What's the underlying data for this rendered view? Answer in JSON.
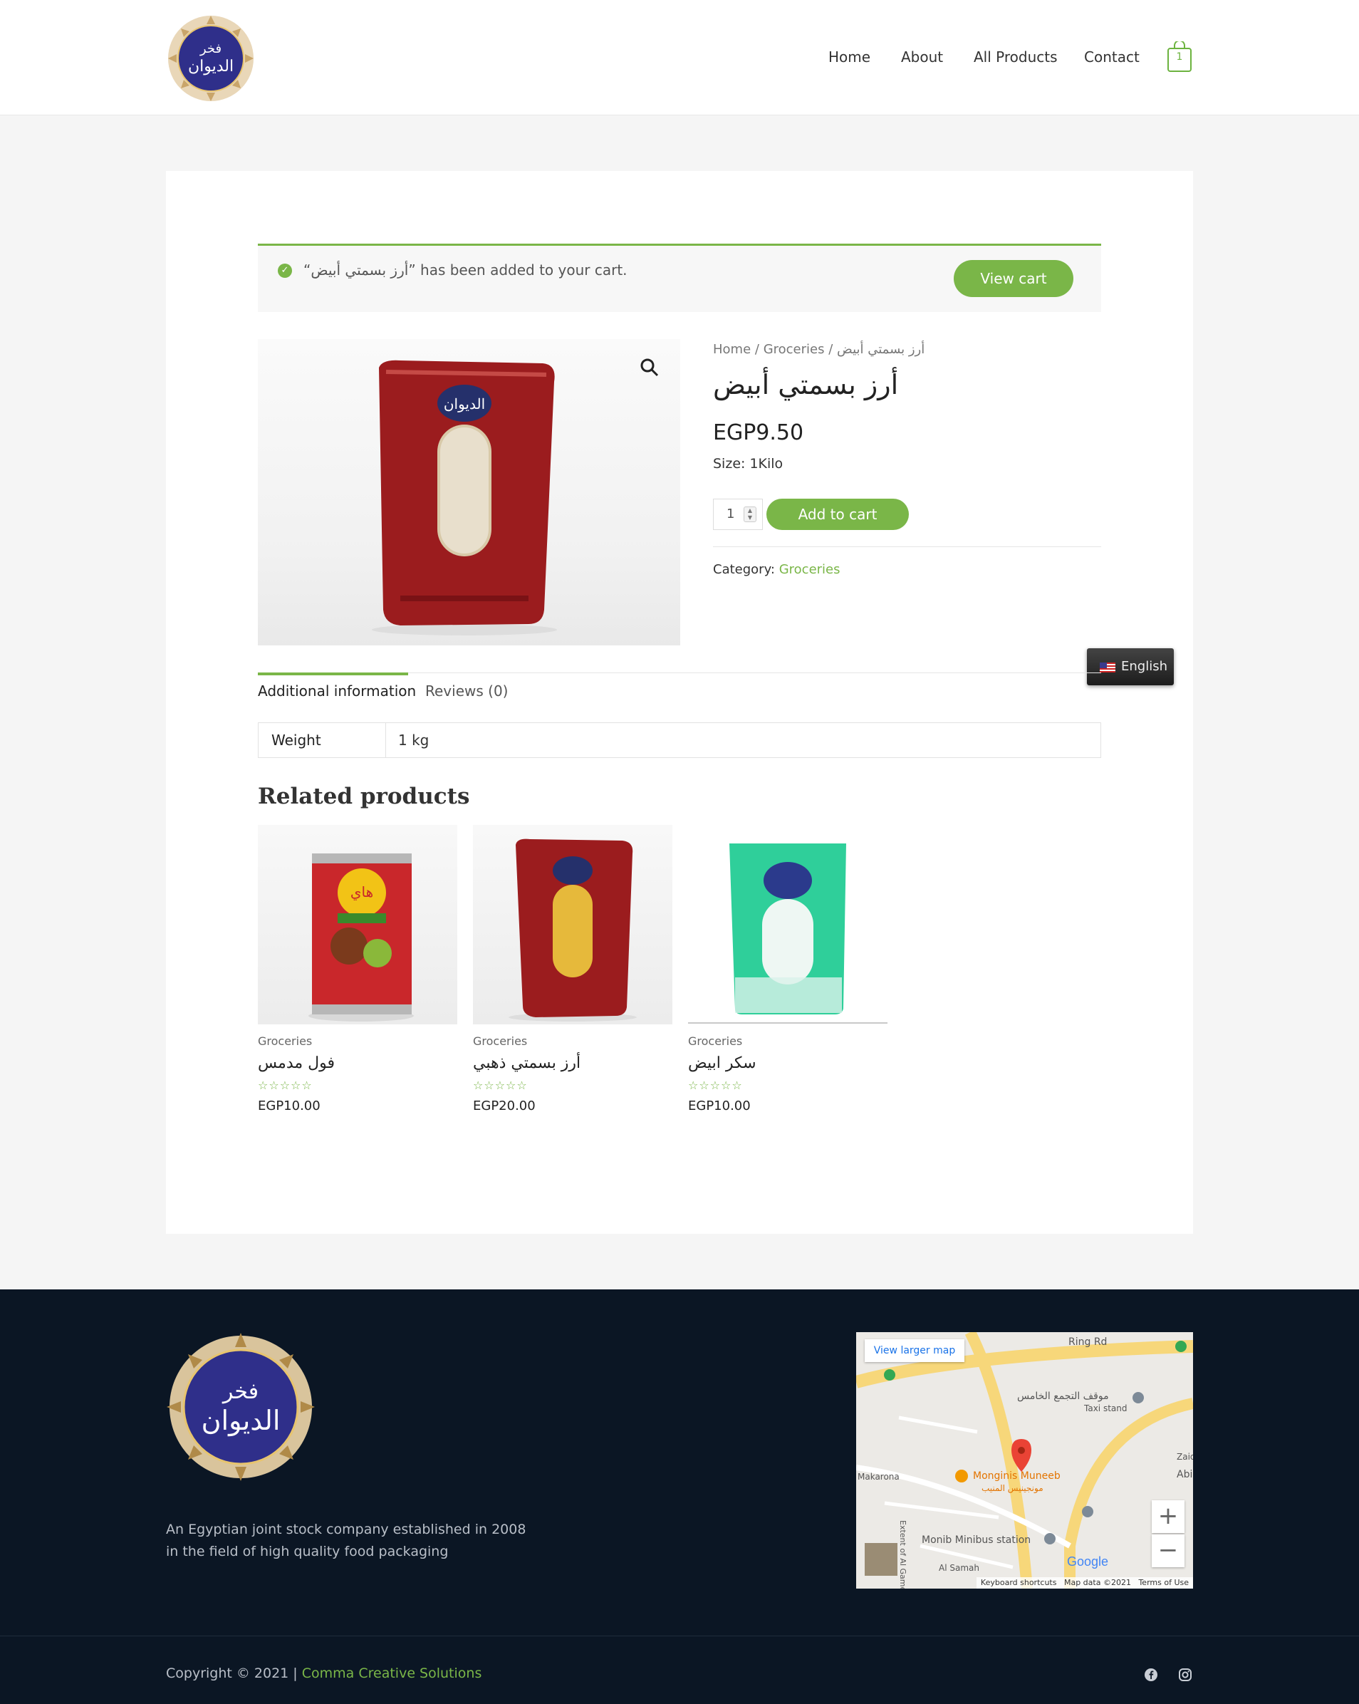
{
  "header": {
    "logo_alt": "فخر الديوان",
    "nav": [
      "Home",
      "About",
      "All Products",
      "Contact"
    ],
    "cart_count": "1"
  },
  "notice": {
    "message": "“أرز بسمتي أبيض” has been added to your cart.",
    "button": "View cart"
  },
  "product": {
    "breadcrumb": [
      "Home",
      "Groceries",
      "أرز بسمتي أبيض"
    ],
    "title": "أرز بسمتي أبيض",
    "price": "EGP9.50",
    "size": "Size: 1Kilo",
    "quantity": "1",
    "add_to_cart": "Add to cart",
    "category_label": "Category:",
    "category": "Groceries"
  },
  "language": "English",
  "tabs": [
    "Additional information",
    "Reviews (0)"
  ],
  "attributes": {
    "label": "Weight",
    "value": "1 kg"
  },
  "related": {
    "title": "Related products",
    "items": [
      {
        "category": "Groceries",
        "name": "فول مدمس",
        "price": "EGP10.00",
        "rating": 0
      },
      {
        "category": "Groceries",
        "name": "أرز بسمتي ذهبي",
        "price": "EGP20.00",
        "rating": 0
      },
      {
        "category": "Groceries",
        "name": "سكر ابيض",
        "price": "EGP10.00",
        "rating": 0
      }
    ]
  },
  "footer": {
    "description": "An Egyptian joint stock company established in 2008 in the field of high quality food packaging",
    "copyright_prefix": "Copyright © 2021 | ",
    "copyright_link": "Comma Creative Solutions",
    "map": {
      "view_larger": "View larger map",
      "labels": [
        "Ring Rd",
        "موقف التجمع الخامس",
        "Taxi stand",
        "Monginis Muneeb",
        "مونجينيس المنيب",
        "Makarona",
        "Monib Minibus station",
        "Al Samah",
        "Zaid",
        "Abi",
        "Extent of Al Gamel"
      ],
      "footer": [
        "Keyboard shortcuts",
        "Map data ©2021",
        "Terms of Use"
      ],
      "google": "Google"
    }
  },
  "colors": {
    "accent": "#7ab648",
    "footer_bg": "#0b1624"
  },
  "icons": [
    "cart-icon",
    "zoom-icon",
    "check-icon",
    "flag-us-icon",
    "star-icon",
    "facebook-icon",
    "instagram-icon",
    "zoom-in-icon",
    "zoom-out-icon"
  ]
}
